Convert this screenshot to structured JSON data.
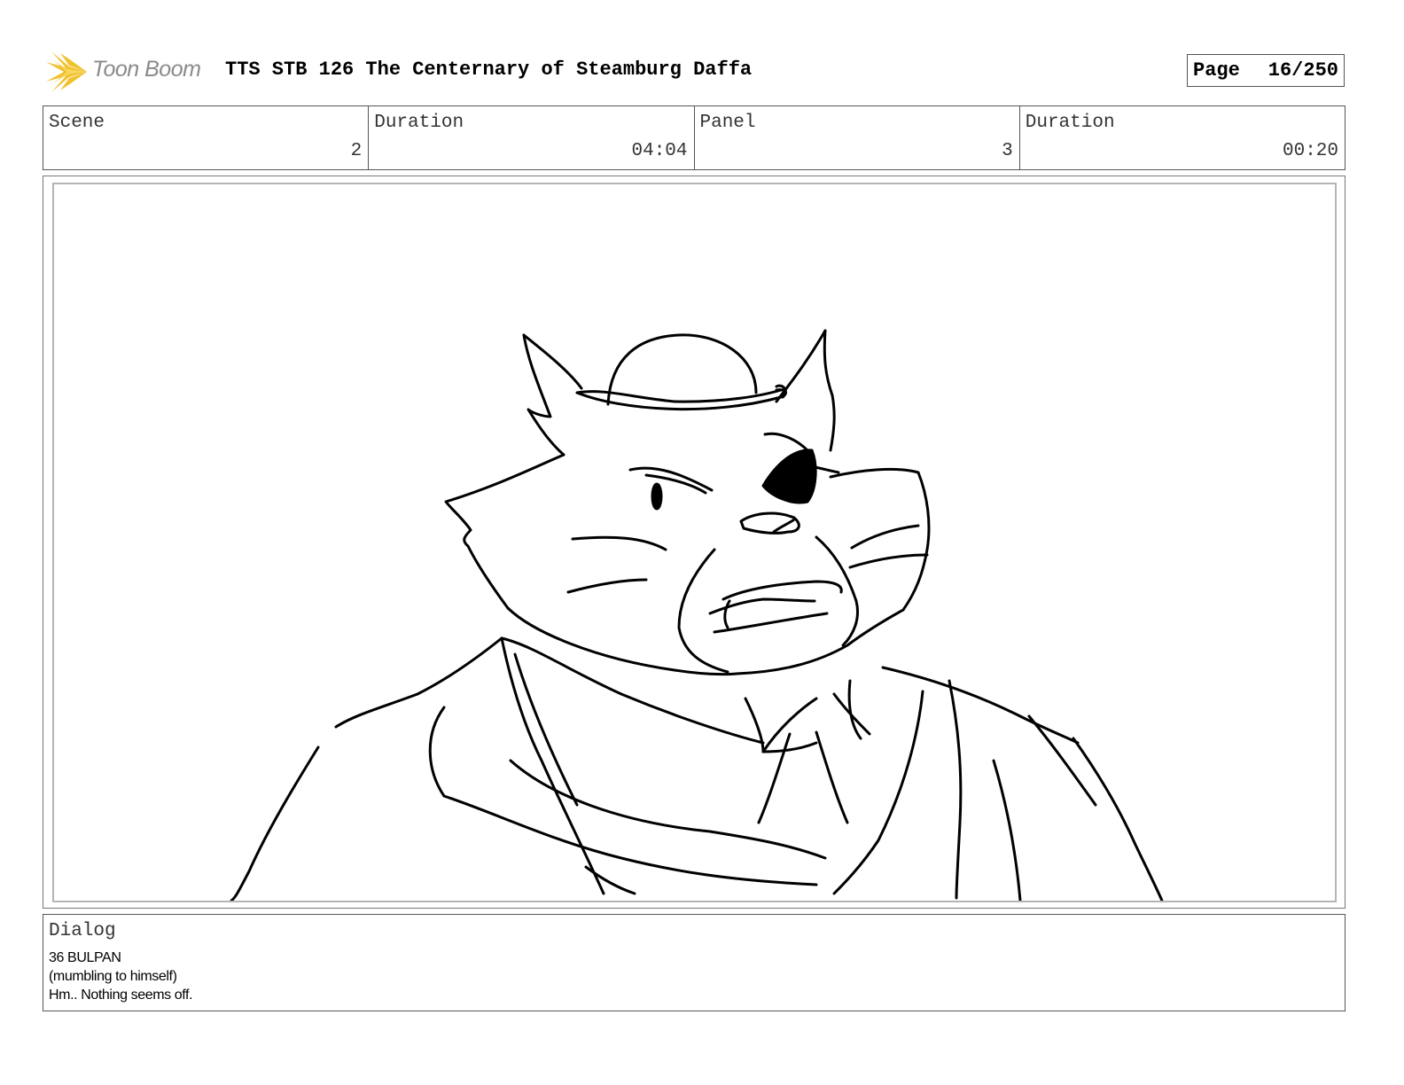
{
  "header": {
    "logo_text": "Toon Boom",
    "title": "TTS STB 126 The Centernary of Steamburg Daffa",
    "page_label": "Page",
    "page_number": "16/250"
  },
  "info": {
    "scene_label": "Scene",
    "scene_value": "2",
    "scene_duration_label": "Duration",
    "scene_duration_value": "04:04",
    "panel_label": "Panel",
    "panel_value": "3",
    "panel_duration_label": "Duration",
    "panel_duration_value": "00:20"
  },
  "dialog": {
    "label": "Dialog",
    "lines": [
      "36 BULPAN",
      "(mumbling to himself)",
      "Hm.. Nothing seems off."
    ]
  },
  "colors": {
    "logo_star": "#f2c12e",
    "logo_text": "#8a8a8a",
    "border": "#555555",
    "panel_inner_border": "#b5b5b5"
  },
  "icons": {
    "logo": "toon-boom-star-icon"
  }
}
